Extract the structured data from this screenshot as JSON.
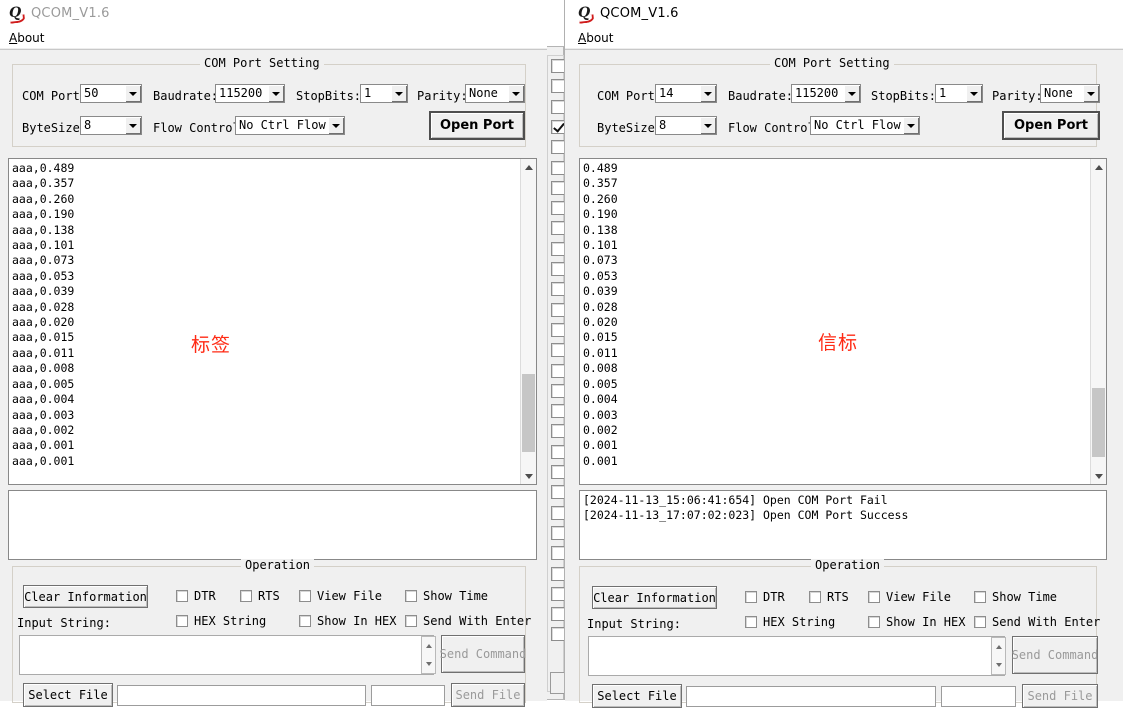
{
  "app": {
    "title": "QCOM_V1.6",
    "menu": [
      {
        "label": "About",
        "accel": "A"
      }
    ],
    "icon": "qcom-logo-icon"
  },
  "colors": {
    "annotation_red": "#ff2a14",
    "face": "#f0f0f0",
    "field": "#ffffff",
    "disabled_text": "#9a9a9a"
  },
  "windows": [
    {
      "id": "left",
      "active": false,
      "title": "QCOM_V1.6",
      "annotation": "标签",
      "com_port_setting": {
        "legend": "COM Port Setting",
        "fields": {
          "com_port_label": "COM Port:",
          "com_port_value": "50",
          "baudrate_label": "Baudrate:",
          "baudrate_value": "115200",
          "stopbits_label": "StopBits:",
          "stopbits_value": "1",
          "parity_label": "Parity:",
          "parity_value": "None",
          "bytesize_label": "ByteSize:",
          "bytesize_value": "8",
          "flow_control_label": "Flow Control:",
          "flow_control_value": "No Ctrl Flow"
        },
        "open_port_button": "Open Port"
      },
      "receive_text": "aaa,0.489\naaa,0.357\naaa,0.260\naaa,0.190\naaa,0.138\naaa,0.101\naaa,0.073\naaa,0.053\naaa,0.039\naaa,0.028\naaa,0.020\naaa,0.015\naaa,0.011\naaa,0.008\naaa,0.005\naaa,0.004\naaa,0.003\naaa,0.002\naaa,0.001\naaa,0.001",
      "log_text": "",
      "operation": {
        "legend": "Operation",
        "clear_button": "Clear Information",
        "input_string_label": "Input String:",
        "input_string_value": "",
        "send_command_button": "Send Command",
        "select_file_button": "Select File",
        "file_path_value": "",
        "file_size_value": "",
        "send_file_button": "Send File",
        "checkboxes": [
          {
            "label": "DTR",
            "checked": false
          },
          {
            "label": "RTS",
            "checked": false
          },
          {
            "label": "View File",
            "checked": false
          },
          {
            "label": "Show Time",
            "checked": false
          },
          {
            "label": "HEX String",
            "checked": false
          },
          {
            "label": "Show In HEX",
            "checked": false
          },
          {
            "label": "Send With Enter",
            "checked": false
          }
        ]
      }
    },
    {
      "id": "right",
      "active": true,
      "title": "QCOM_V1.6",
      "annotation": "信标",
      "com_port_setting": {
        "legend": "COM Port Setting",
        "fields": {
          "com_port_label": "COM Port:",
          "com_port_value": "14",
          "baudrate_label": "Baudrate:",
          "baudrate_value": "115200",
          "stopbits_label": "StopBits:",
          "stopbits_value": "1",
          "parity_label": "Parity:",
          "parity_value": "None",
          "bytesize_label": "ByteSize:",
          "bytesize_value": "8",
          "flow_control_label": "Flow Control:",
          "flow_control_value": "No Ctrl Flow"
        },
        "open_port_button": "Open Port"
      },
      "receive_text": "0.489\n0.357\n0.260\n0.190\n0.138\n0.101\n0.073\n0.053\n0.039\n0.028\n0.020\n0.015\n0.011\n0.008\n0.005\n0.004\n0.003\n0.002\n0.001\n0.001",
      "log_text": "[2024-11-13_15:06:41:654] Open COM Port Fail\n[2024-11-13_17:07:02:023] Open COM Port Success",
      "operation": {
        "legend": "Operation",
        "clear_button": "Clear Information",
        "input_string_label": "Input String:",
        "input_string_value": "",
        "send_command_button": "Send Command",
        "select_file_button": "Select File",
        "file_path_value": "",
        "file_size_value": "",
        "send_file_button": "Send File",
        "checkboxes": [
          {
            "label": "DTR",
            "checked": false
          },
          {
            "label": "RTS",
            "checked": false
          },
          {
            "label": "View File",
            "checked": false
          },
          {
            "label": "Show Time",
            "checked": false
          },
          {
            "label": "HEX String",
            "checked": false
          },
          {
            "label": "Show In HEX",
            "checked": false
          },
          {
            "label": "Send With Enter",
            "checked": false
          }
        ]
      }
    }
  ],
  "background_window": {
    "checkbox_column_checked_index": 3,
    "checkbox_count": 31
  }
}
